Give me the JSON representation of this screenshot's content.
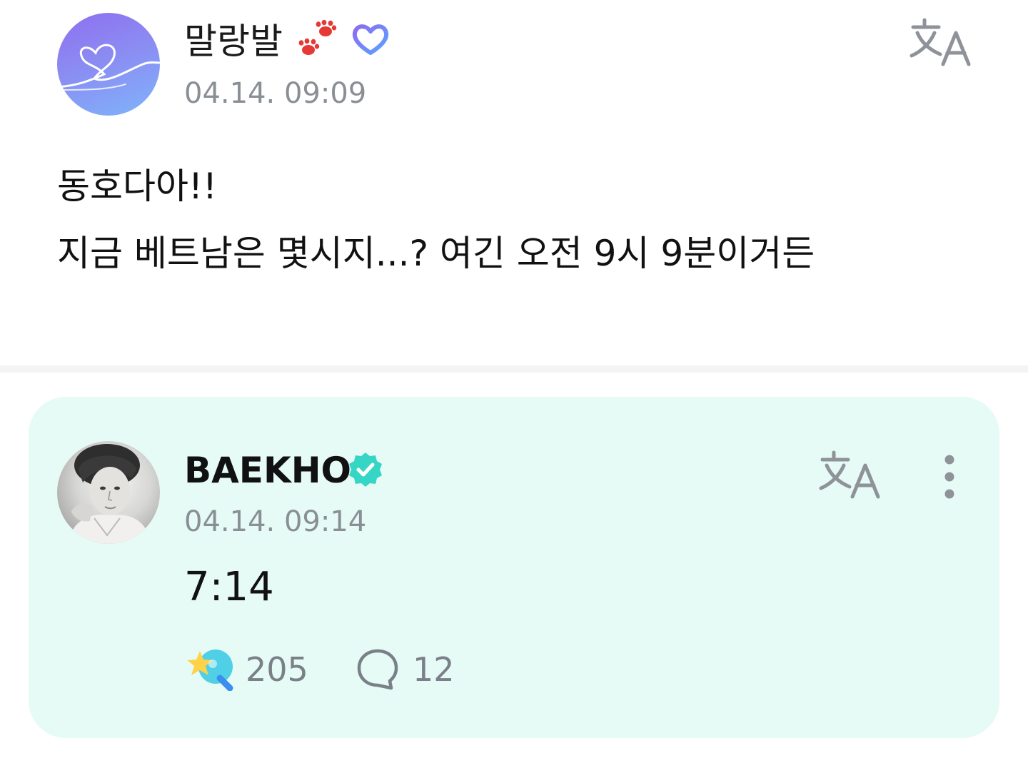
{
  "post": {
    "author": "말랑발",
    "author_emoji_icon": "paw-prints-icon",
    "author_badge_icon": "fan-membership-badge-icon",
    "timestamp": "04.14. 09:09",
    "body_lines": [
      "동호다아!!",
      "지금 베트남은 몇시지...? 여긴 오전 9시 9분이거든"
    ],
    "translate_icon": "translate-icon"
  },
  "reply": {
    "author": "BAEKHO",
    "verified_icon": "verified-check-icon",
    "timestamp": "04.14. 09:14",
    "body": "7:14",
    "translate_icon": "translate-icon",
    "more_icon": "more-vertical-icon",
    "like_icon": "cheer-star-icon",
    "like_count": "205",
    "comment_icon": "comment-bubble-icon",
    "comment_count": "12"
  },
  "colors": {
    "reply_background": "#e6fbf5",
    "timestamp_gray": "#8a8f96",
    "verified_teal": "#36d6c6",
    "badge_purple": "#8c6cf0",
    "badge_blue": "#5aa2ff",
    "paw_red": "#e53935",
    "fan_avatar_gradient_start": "#8e6ff0",
    "fan_avatar_gradient_end": "#7fb4fb"
  }
}
